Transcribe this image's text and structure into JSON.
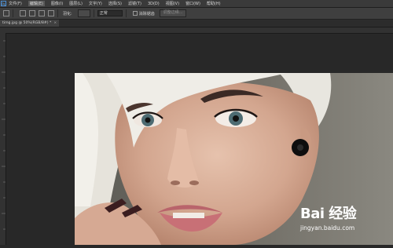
{
  "menubar": {
    "logo_text": "Ps",
    "items": [
      "文件(F)",
      "编辑(E)",
      "图像(I)",
      "图层(L)",
      "文字(Y)",
      "选择(S)",
      "滤镜(T)",
      "3D(D)",
      "视图(V)",
      "窗口(W)",
      "帮助(H)"
    ]
  },
  "options_bar": {
    "feather_label": "羽化:",
    "style_select": "正常",
    "antialias_label": "消除锯齿",
    "refine_edge_button": "调整边缘..."
  },
  "document_tab": {
    "title": "timg.jpg @ 50%(RGB/8#) *",
    "close_glyph": "×"
  },
  "watermark": {
    "brand": "Bai 经验",
    "url": "jingyan.baidu.com"
  },
  "colors": {
    "menubar_bg": "#3a3a3a",
    "workspace_bg": "#282828",
    "highlight_blue": "#4b8fd6"
  }
}
